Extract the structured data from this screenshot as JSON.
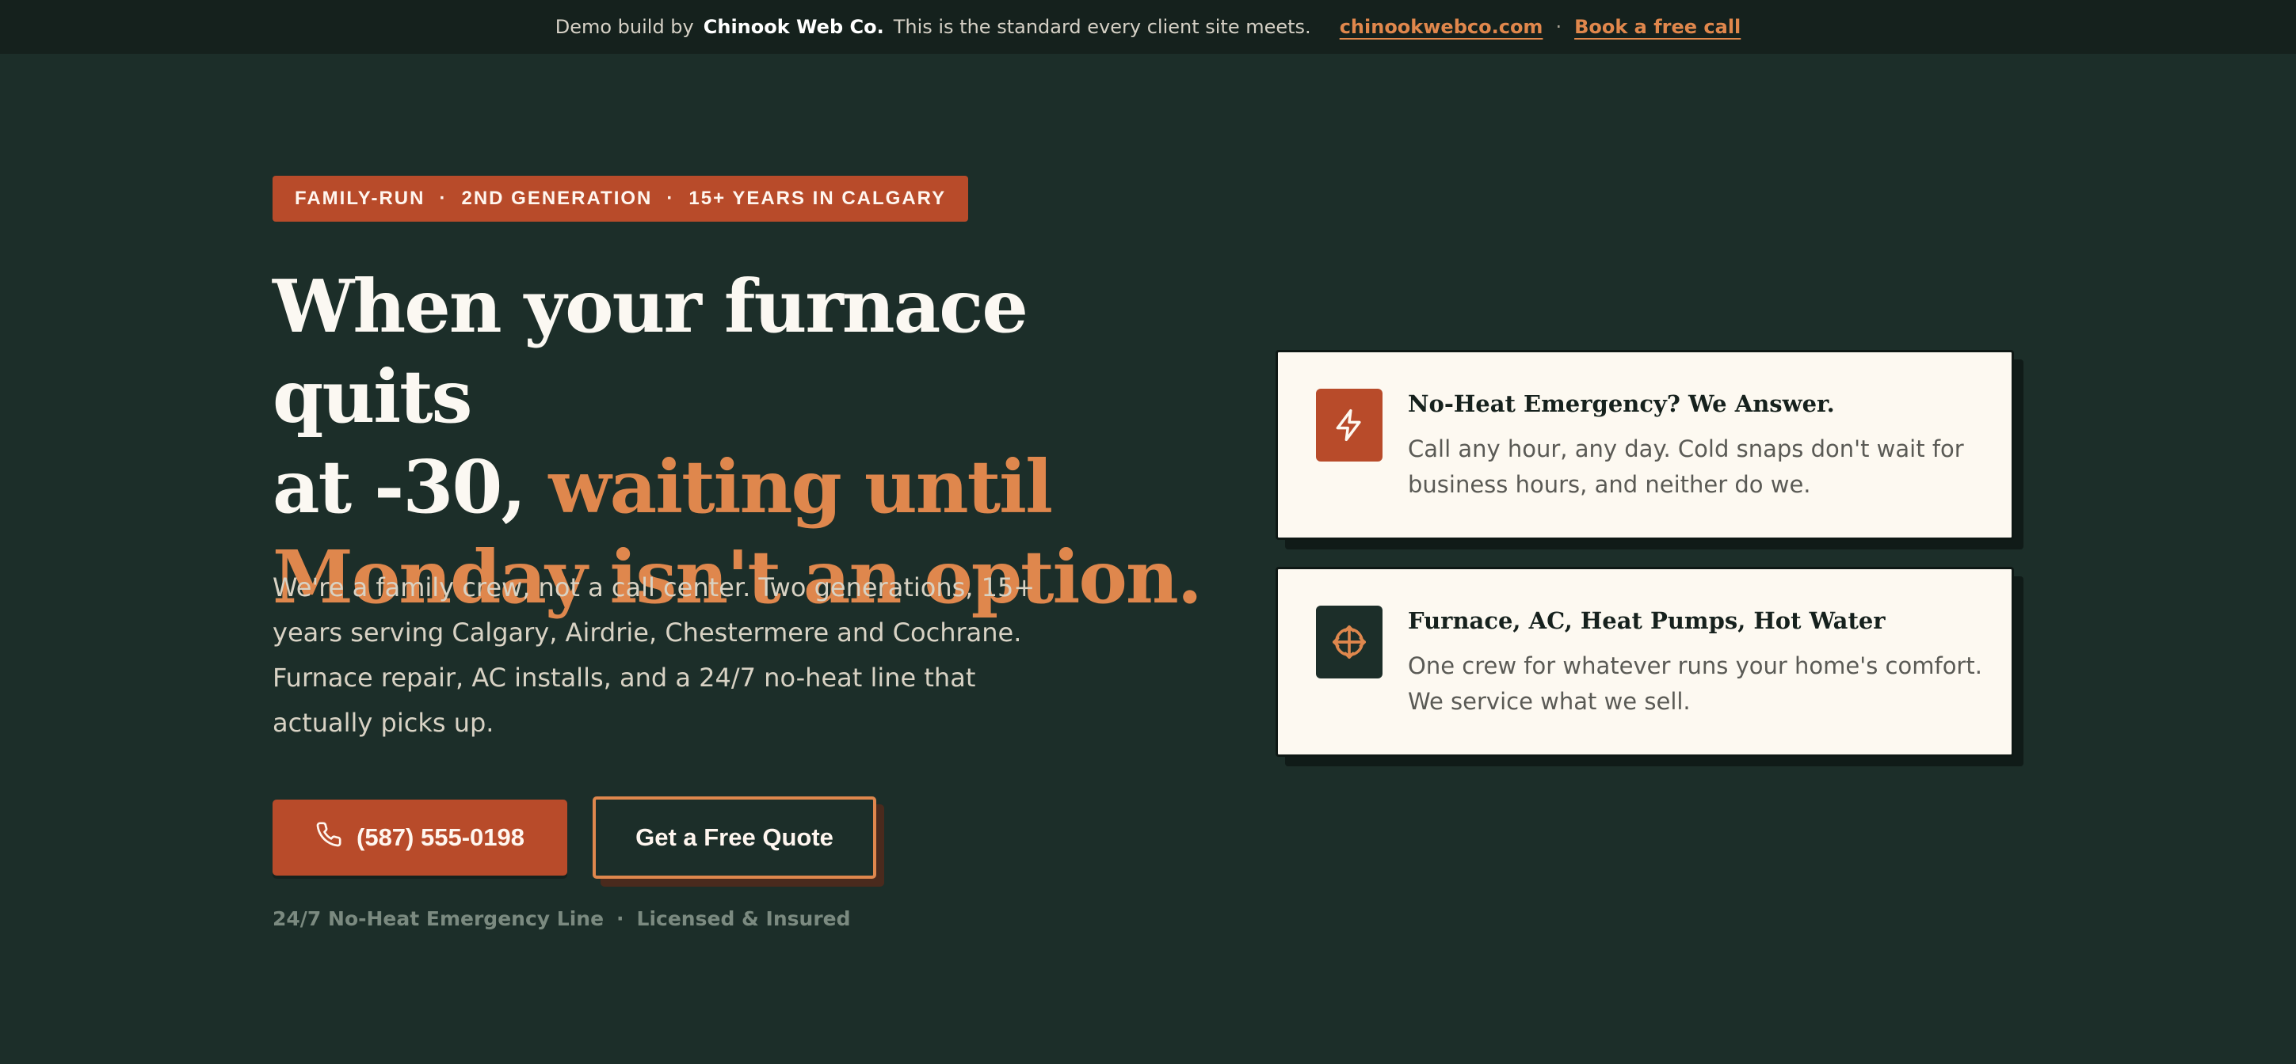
{
  "topbar": {
    "prefix": "Demo build by",
    "brand": "Chinook Web Co.",
    "suffix": "This is the standard every client site meets.",
    "link_site": "chinookwebco.com",
    "separator": "·",
    "link_call": "Book a free call"
  },
  "hero": {
    "badge": {
      "items": [
        "FAMILY-RUN",
        "2ND GENERATION",
        "15+ YEARS IN CALGARY"
      ],
      "separator": "·"
    },
    "headline": {
      "line1": "When your furnace quits",
      "line2_plain": "at -30,",
      "line2_accent": "waiting until",
      "line3_accent": "Monday isn't an option."
    },
    "lede": "We're a family crew, not a call center. Two generations, 15+ years serving Calgary, Airdrie, Chestermere and Cochrane. Furnace repair, AC installs, and a 24/7 no-heat line that actually picks up.",
    "cta_call": {
      "label": "(587) 555-0198",
      "icon": "phone-icon"
    },
    "cta_quote": {
      "label": "Get a Free Quote"
    },
    "trust": {
      "item1": "24/7 No-Heat Emergency Line",
      "separator": "·",
      "item2": "Licensed & Insured"
    }
  },
  "features": [
    {
      "icon": "lightning-icon",
      "title": "No-Heat Emergency? We Answer.",
      "description": "Call any hour, any day. Cold snaps don't wait for business hours, and neither do we."
    },
    {
      "icon": "arrows-move-icon",
      "title": "Furnace, AC, Heat Pumps, Hot Water",
      "description": "One crew for whatever runs your home's comfort. We service what we sell."
    }
  ],
  "colors": {
    "background": "#1c2e29",
    "topbar": "#15211d",
    "accent": "#df874d",
    "brand_rust": "#b84b2a",
    "card": "#fdf9f1"
  }
}
